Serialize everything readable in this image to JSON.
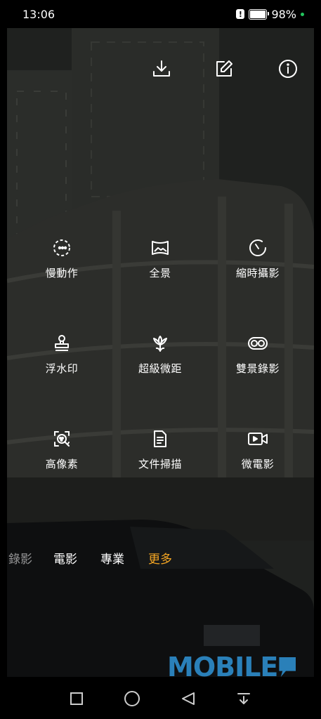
{
  "status_bar": {
    "time": "13:06",
    "alert_glyph": "!",
    "battery_percent": "98%",
    "battery_level": 0.98
  },
  "top_actions": {
    "icons": [
      "download-icon",
      "edit-icon",
      "info-icon"
    ]
  },
  "modes": [
    {
      "label": "慢動作",
      "icon": "slow-motion-icon"
    },
    {
      "label": "全景",
      "icon": "panorama-icon"
    },
    {
      "label": "縮時攝影",
      "icon": "time-lapse-icon"
    },
    {
      "label": "浮水印",
      "icon": "watermark-stamp-icon"
    },
    {
      "label": "超級微距",
      "icon": "macro-flower-icon"
    },
    {
      "label": "雙景錄影",
      "icon": "dual-view-icon"
    },
    {
      "label": "高像素",
      "icon": "high-pixel-icon"
    },
    {
      "label": "文件掃描",
      "icon": "document-scan-icon"
    },
    {
      "label": "微電影",
      "icon": "movie-camera-icon"
    }
  ],
  "mode_tabs": [
    {
      "label": "錄影",
      "state": "faded"
    },
    {
      "label": "電影",
      "state": "normal"
    },
    {
      "label": "專業",
      "state": "normal"
    },
    {
      "label": "更多",
      "state": "active"
    }
  ],
  "watermark": {
    "text": "MOBILE"
  },
  "nav_bar": {
    "icons": [
      "recents-square-icon",
      "home-circle-icon",
      "back-triangle-icon",
      "dropdown-menu-icon"
    ]
  },
  "colors": {
    "active_tab": "#f5a623",
    "watermark": "#2a80b9",
    "battery_dot": "#22c55e"
  }
}
